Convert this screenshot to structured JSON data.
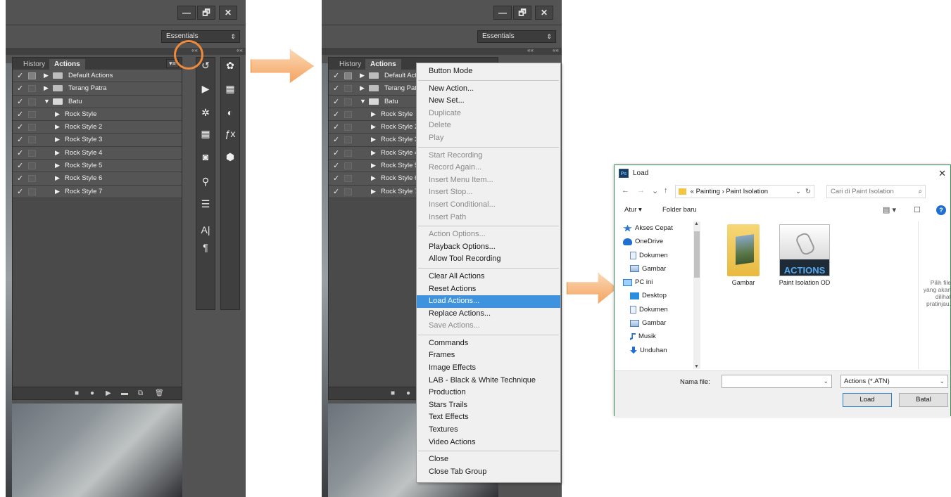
{
  "window_controls": {
    "minimize": "—",
    "restore": "🗗",
    "close": "✕"
  },
  "workspace": {
    "label": "Essentials",
    "arrow": "⇕"
  },
  "collapse_glyph": "««",
  "tabs": [
    {
      "label": "History"
    },
    {
      "label": "Actions"
    }
  ],
  "panel_menu_glyph": "▾≡",
  "actions_list": [
    {
      "label": "Default Actions",
      "check": "✓",
      "dialog_on": true,
      "type": "set",
      "expanded": false
    },
    {
      "label": "Terang Patra",
      "check": "✓",
      "dialog_on": false,
      "type": "set",
      "expanded": false
    },
    {
      "label": "Batu",
      "check": "✓",
      "dialog_on": false,
      "type": "set",
      "expanded": true
    },
    {
      "label": "Rock Style",
      "check": "✓",
      "dialog_on": false,
      "type": "action"
    },
    {
      "label": "Rock Style 2",
      "check": "✓",
      "dialog_on": false,
      "type": "action"
    },
    {
      "label": "Rock Style 3",
      "check": "✓",
      "dialog_on": false,
      "type": "action"
    },
    {
      "label": "Rock Style 4",
      "check": "✓",
      "dialog_on": false,
      "type": "action"
    },
    {
      "label": "Rock Style 5",
      "check": "✓",
      "dialog_on": false,
      "type": "action"
    },
    {
      "label": "Rock Style 6",
      "check": "✓",
      "dialog_on": false,
      "type": "action"
    },
    {
      "label": "Rock Style 7",
      "check": "✓",
      "dialog_on": false,
      "type": "action"
    }
  ],
  "panel_footer": {
    "stop": "■",
    "record": "●",
    "play": "▶",
    "new_set": "▬",
    "new_action": "⧉",
    "delete": "🗑"
  },
  "tool_icons_col1": [
    "↺",
    "▶",
    "✲",
    "▦",
    "◙",
    "⚲",
    "☰",
    "A|",
    "¶"
  ],
  "tool_icons_col2": [
    "✿",
    "▦",
    "◐",
    "ƒx",
    "⬢"
  ],
  "context_menu": {
    "groups": [
      [
        {
          "label": "Button Mode",
          "disabled": false
        }
      ],
      [
        {
          "label": "New Action...",
          "disabled": false
        },
        {
          "label": "New Set...",
          "disabled": false
        },
        {
          "label": "Duplicate",
          "disabled": true
        },
        {
          "label": "Delete",
          "disabled": true
        },
        {
          "label": "Play",
          "disabled": true
        }
      ],
      [
        {
          "label": "Start Recording",
          "disabled": true
        },
        {
          "label": "Record Again...",
          "disabled": true
        },
        {
          "label": "Insert Menu Item...",
          "disabled": true
        },
        {
          "label": "Insert Stop...",
          "disabled": true
        },
        {
          "label": "Insert Conditional...",
          "disabled": true
        },
        {
          "label": "Insert Path",
          "disabled": true
        }
      ],
      [
        {
          "label": "Action Options...",
          "disabled": true
        },
        {
          "label": "Playback Options...",
          "disabled": false
        },
        {
          "label": "Allow Tool Recording",
          "disabled": false
        }
      ],
      [
        {
          "label": "Clear All Actions",
          "disabled": false
        },
        {
          "label": "Reset Actions",
          "disabled": false
        },
        {
          "label": "Load Actions...",
          "disabled": false,
          "highlighted": true
        },
        {
          "label": "Replace Actions...",
          "disabled": false
        },
        {
          "label": "Save Actions...",
          "disabled": true
        }
      ],
      [
        {
          "label": "Commands",
          "disabled": false
        },
        {
          "label": "Frames",
          "disabled": false
        },
        {
          "label": "Image Effects",
          "disabled": false
        },
        {
          "label": "LAB - Black & White Technique",
          "disabled": false
        },
        {
          "label": "Production",
          "disabled": false
        },
        {
          "label": "Stars Trails",
          "disabled": false
        },
        {
          "label": "Text Effects",
          "disabled": false
        },
        {
          "label": "Textures",
          "disabled": false
        },
        {
          "label": "Video Actions",
          "disabled": false
        }
      ],
      [
        {
          "label": "Close",
          "disabled": false
        },
        {
          "label": "Close Tab Group",
          "disabled": false
        }
      ]
    ]
  },
  "dialog": {
    "app_icon": "Ps",
    "title": "Load",
    "close": "✕",
    "nav": {
      "back": "←",
      "forward": "→",
      "history": "⌄",
      "up": "↑"
    },
    "breadcrumb": {
      "prefix": "«",
      "parts": [
        "Painting",
        "Paint Isolation"
      ],
      "sep": "›",
      "dropdown": "⌄",
      "refresh": "↻"
    },
    "search_placeholder": "Cari di Paint Isolation",
    "search_icon": "⌕",
    "toolbar": {
      "organize": "Atur ▾",
      "new_folder": "Folder baru",
      "view": "▤ ▾",
      "pane": "☐",
      "help": "?"
    },
    "nav_items": [
      {
        "label": "Akses Cepat",
        "icon": "star-icon",
        "color": "#2b79d0",
        "indent": 0
      },
      {
        "label": "OneDrive",
        "icon": "cloud-icon",
        "color": "#1f6fd1",
        "indent": 0
      },
      {
        "label": "Dokumen",
        "icon": "document-icon",
        "color": "#5b8cc7",
        "indent": 1
      },
      {
        "label": "Gambar",
        "icon": "picture-icon",
        "color": "#4f7fb8",
        "indent": 1
      },
      {
        "label": "PC ini",
        "icon": "computer-icon",
        "color": "#2d83db",
        "indent": 0
      },
      {
        "label": "Desktop",
        "icon": "desktop-icon",
        "color": "#2a8ee0",
        "indent": 1
      },
      {
        "label": "Dokumen",
        "icon": "document-icon",
        "color": "#5b8cc7",
        "indent": 1
      },
      {
        "label": "Gambar",
        "icon": "picture-icon",
        "color": "#4f7fb8",
        "indent": 1
      },
      {
        "label": "Musik",
        "icon": "music-icon",
        "color": "#1f6fd1",
        "indent": 1
      },
      {
        "label": "Unduhan",
        "icon": "download-icon",
        "color": "#1f6fd1",
        "indent": 1
      }
    ],
    "files": [
      {
        "name": "Gambar",
        "type": "folder"
      },
      {
        "name": "Paint Isolation OD",
        "type": "atn",
        "badge": "ACTIONS"
      }
    ],
    "preview_text": "Pilih file yang akan dilihat pratinjau.",
    "filename_label": "Nama file:",
    "filename_value": "",
    "filetype": "Actions (*.ATN)",
    "load_button": "Load",
    "cancel_button": "Batal"
  }
}
